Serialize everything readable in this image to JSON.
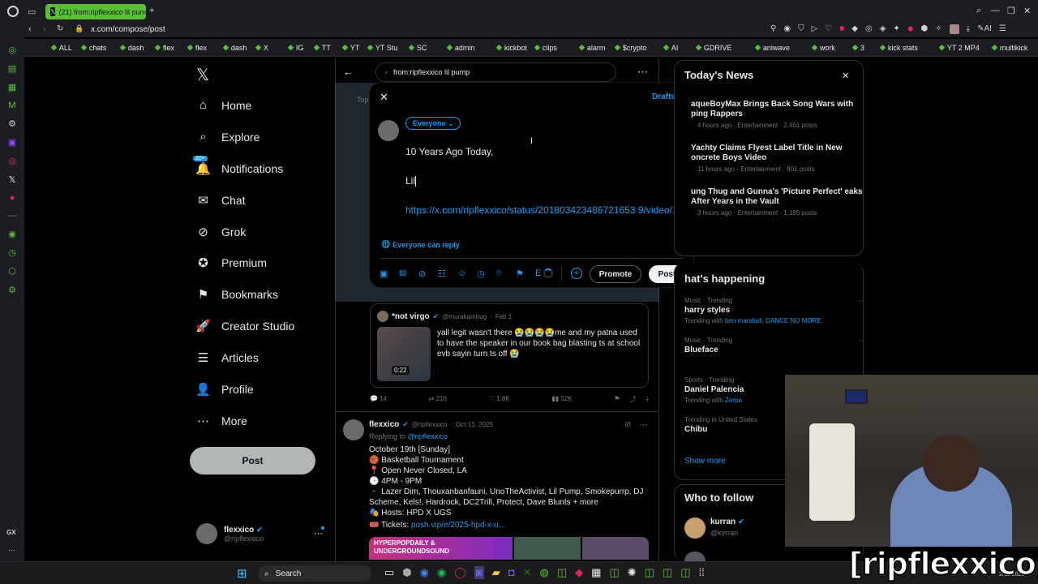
{
  "browser": {
    "tab_title": "(21) from:ripflexxico lil pum",
    "url": "x.com/compose/post",
    "bookmarks": [
      "ALL",
      "chats",
      "dash",
      "flex",
      "flex",
      "dash",
      "X",
      "IG",
      "TT",
      "YT",
      "YT Stu",
      "SC",
      "admin",
      "kickbot",
      "clips",
      "alarm",
      "$crypto",
      "AI",
      "GDRIVE",
      "aniwave",
      "work",
      "3",
      "kick stats",
      "YT 2 MP4",
      "multikick"
    ]
  },
  "sidebar": {
    "items": [
      {
        "label": "Home",
        "icon": "home-icon"
      },
      {
        "label": "Explore",
        "icon": "search-icon"
      },
      {
        "label": "Notifications",
        "icon": "bell-icon",
        "badge": "20+"
      },
      {
        "label": "Chat",
        "icon": "mail-icon"
      },
      {
        "label": "Grok",
        "icon": "grok-icon"
      },
      {
        "label": "Premium",
        "icon": "verified-icon"
      },
      {
        "label": "Bookmarks",
        "icon": "bookmark-icon"
      },
      {
        "label": "Creator Studio",
        "icon": "rocket-icon"
      },
      {
        "label": "Articles",
        "icon": "articles-icon"
      },
      {
        "label": "Profile",
        "icon": "person-icon"
      },
      {
        "label": "More",
        "icon": "more-circle-icon"
      }
    ],
    "post_label": "Post",
    "account": {
      "name": "flexxico",
      "handle": "@ripflexxico"
    }
  },
  "search": {
    "query": "from:ripflexxico lil pump",
    "tab_partial": "Top"
  },
  "compose": {
    "drafts_label": "Drafts",
    "audience": "Everyone",
    "line1": "10 Years Ago Today,",
    "line2": "Lil",
    "link": "https://x.com/ripflexxico/status/201803423486721653 9/video/1",
    "reply_setting": "Everyone can reply",
    "promote_label": "Promote",
    "post_label": "Post"
  },
  "feed": {
    "tweet1": {
      "name": "*not virgo",
      "handle": "@murakamirug",
      "date": "Feb 1",
      "text": "yall legit wasn't there 😭😭😭😭me and my patna used to have the speaker in our book bag blasting ts at school evb sayin turn ts off 😭",
      "duration": "0:22",
      "stats": {
        "replies": "14",
        "reposts": "216",
        "likes": "1.8K",
        "views": "52K"
      }
    },
    "tweet2": {
      "name": "flexxico",
      "handle": "@ripflexxico",
      "date": "Oct 13, 2025",
      "replying_prefix": "Replying to",
      "replying_to": "@ripflexxico",
      "lines": [
        "October 19th [Sunday]",
        "🏀 Basketball Tournament",
        "📍 Open Never Closed, LA",
        "🕓 4PM - 9PM",
        "▪️ Lazer Dim, Thouxanbanfauni, UnoTheActivist, Lil Pump, Smokepurrp, DJ Scheme, Kels!, Hardrock, DC2Trill, Protect, Dave Blunts + more",
        "🎭 Hosts: HPD X UGS"
      ],
      "tickets_label": "🎟️ Tickets:",
      "tickets_link": "posh.vip/e/2025-hpd-x-u...",
      "banner": "HYPERPOPDAILY & UNDERGROUNDSOUND"
    }
  },
  "news": {
    "title": "Today's News",
    "items": [
      {
        "headline": "aqueBoyMax Brings Back Song Wars with ping Rappers",
        "meta": "4 hours ago · Entertainment · 2,401 posts"
      },
      {
        "headline": "Yachty Claims Flyest Label Title in New oncrete Boys Video",
        "meta": "11 hours ago · Entertainment · 801 posts"
      },
      {
        "headline": "ung Thug and Gunna's 'Picture Perfect' eaks After Years in the Vault",
        "meta": "3 hours ago · Entertainment · 1,195 posts"
      }
    ]
  },
  "happening": {
    "title": "hat's happening",
    "items": [
      {
        "context": "Music · Trending",
        "topic": "harry styles",
        "with_prefix": "Trending with",
        "with": "ben marshall, DANCE NO MORE"
      },
      {
        "context": "Music · Trending",
        "topic": "Blueface",
        "with_prefix": "",
        "with": ""
      },
      {
        "context": "Sports · Trending",
        "topic": "Daniel Palencia",
        "with_prefix": "Trending with",
        "with": "Zerpa"
      },
      {
        "context": "Trending in United States",
        "topic": "Chibu",
        "with_prefix": "",
        "with": ""
      }
    ],
    "show_more": "Show more"
  },
  "follow": {
    "title": "Who to follow",
    "user": "kurran",
    "handle": "@kvrran"
  },
  "taskbar": {
    "search": "Search",
    "date": "2/13/2026"
  },
  "watermark": "[ripflexxico]"
}
